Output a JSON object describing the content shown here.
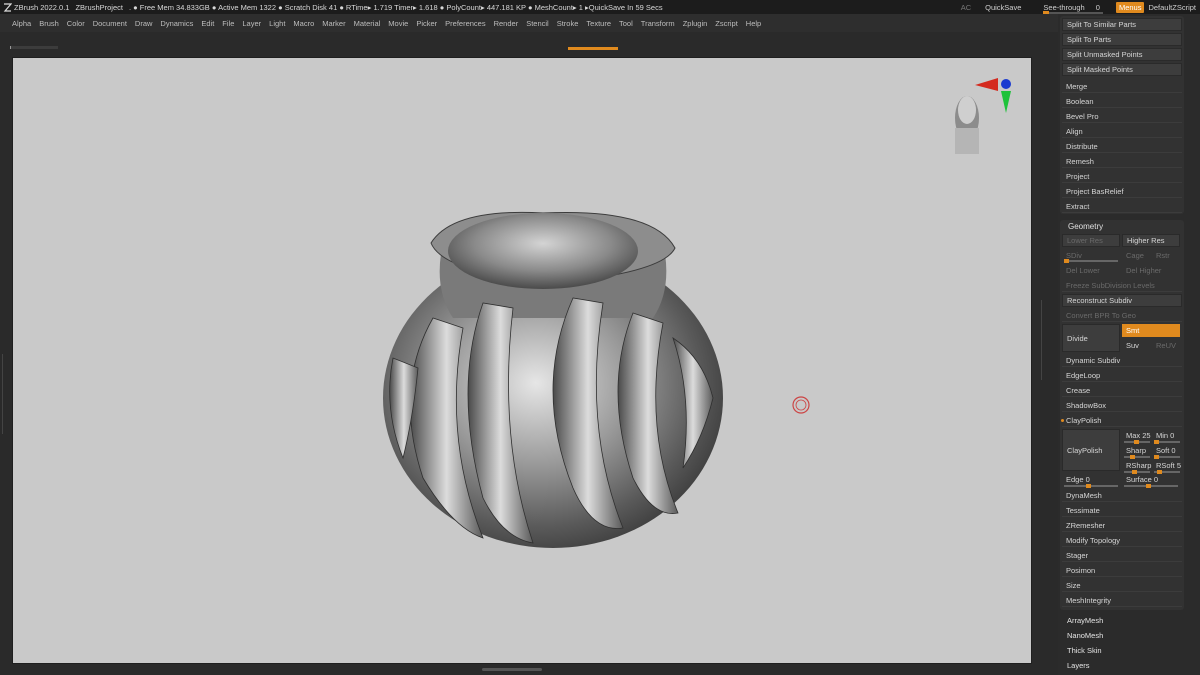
{
  "titlebar": {
    "app": "ZBrush 2022.0.1",
    "project": "ZBrushProject",
    "stats": ". ● Free Mem 34.833GB ● Active Mem 1322 ● Scratch Disk 41 ●  RTime▸ 1.719 Timer▸ 1.618 ● PolyCount▸ 447.181 KP  ● MeshCount▸ 1  ▸QuickSave In 59 Secs",
    "ac": "AC",
    "quicksave": "QuickSave",
    "see_through_label": "See-through",
    "see_through_value": "0",
    "see_through_fraction": 0.0,
    "menus": "Menus",
    "script": "DefaultZScript"
  },
  "menu": [
    "Alpha",
    "Brush",
    "Color",
    "Document",
    "Draw",
    "Dynamics",
    "Edit",
    "File",
    "Layer",
    "Light",
    "Macro",
    "Marker",
    "Material",
    "Movie",
    "Picker",
    "Preferences",
    "Render",
    "Stencil",
    "Stroke",
    "Texture",
    "Tool",
    "Transform",
    "Zplugin",
    "Zscript",
    "Help"
  ],
  "subtool_panel": {
    "top_boxed": [
      "Split To Similar Parts",
      "Split To Parts",
      "Split Unmasked Points",
      "Split Masked Points"
    ],
    "items": [
      "Merge",
      "Boolean",
      "Bevel Pro",
      "Align",
      "Distribute",
      "Remesh",
      "Project",
      "Project BasRelief",
      "Extract"
    ]
  },
  "geometry": {
    "title": "Geometry",
    "lower_res": "Lower Res",
    "higher_res": "Higher Res",
    "sdiv": "SDiv",
    "cage": "Cage",
    "rstr": "Rstr",
    "del_lower": "Del Lower",
    "del_higher": "Del Higher",
    "freeze": "Freeze SubDivision Levels",
    "reconstruct": "Reconstruct Subdiv",
    "convert": "Convert BPR To Geo",
    "divide": "Divide",
    "smt": "Smt",
    "suv": "Suv",
    "reuv": "ReUV",
    "dynamic_subdiv": "Dynamic Subdiv",
    "edgeloop": "EdgeLoop",
    "crease": "Crease",
    "shadowbox": "ShadowBox",
    "claypolish_header": "ClayPolish",
    "claypolish_btn": "ClayPolish",
    "max": "Max 25",
    "min": "Min 0",
    "sharp": "Sharp",
    "soft": "Soft 0",
    "rsharp": "RSharp",
    "rsoft": "RSoft 5",
    "edge": "Edge 0",
    "surface": "Surface 0",
    "after": [
      "DynaMesh",
      "Tessimate",
      "ZRemesher",
      "Modify Topology",
      "Stager",
      "Posimon",
      "Size",
      "MeshIntegrity"
    ]
  },
  "tail_items": [
    "ArrayMesh",
    "NanoMesh",
    "Thick Skin",
    "Layers"
  ],
  "colors": {
    "accent": "#e08a1e",
    "canvas": "#c9c9c9",
    "panel": "#2b2b2b"
  }
}
